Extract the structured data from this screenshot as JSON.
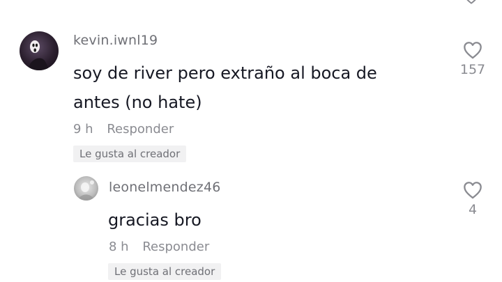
{
  "comments": [
    {
      "username": "kevin.iwnl19",
      "text_line1": "soy de river pero extraño al boca de",
      "text_line2": "antes (no hate)",
      "time": "9 h",
      "reply_label": "Responder",
      "badge": "Le gusta al creador",
      "likes": "157",
      "avatar_icon": "masked-figure-avatar"
    },
    {
      "username": "leonelmendez46",
      "text": "gracias bro",
      "time": "8 h",
      "reply_label": "Responder",
      "badge": "Le gusta al creador",
      "likes": "4",
      "avatar_icon": "photo-avatar"
    }
  ],
  "icons": {
    "like": "heart-outline-icon"
  },
  "colors": {
    "text": "#161823",
    "secondary": "#8a8b91",
    "badge_bg": "#f1f1f2"
  }
}
